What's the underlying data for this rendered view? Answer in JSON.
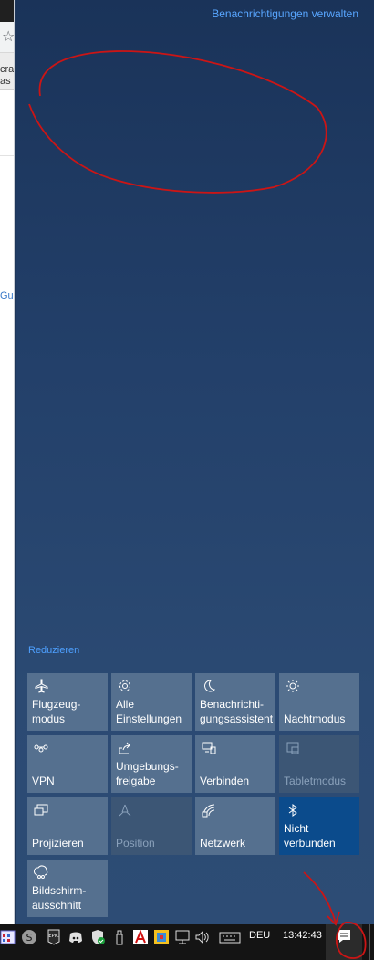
{
  "background_app": {
    "tab_text_1": "cra",
    "tab_text_2": "as",
    "link_text": "Gu"
  },
  "action_center": {
    "manage_notifications": "Benachrichtigungen verwalten",
    "collapse": "Reduzieren",
    "tiles": [
      {
        "label": "Flugzeug-\nmodus",
        "icon": "airplane-icon",
        "state": "off"
      },
      {
        "label": "Alle\nEinstellungen",
        "icon": "gear-icon",
        "state": "off"
      },
      {
        "label": "Benachrichti-\ngungsassistent",
        "icon": "moon-icon",
        "state": "off"
      },
      {
        "label": "Nachtmodus",
        "icon": "brightness-icon",
        "state": "off"
      },
      {
        "label": "VPN",
        "icon": "vpn-icon",
        "state": "off"
      },
      {
        "label": "Umgebungs-\nfreigabe",
        "icon": "share-icon",
        "state": "off"
      },
      {
        "label": "Verbinden",
        "icon": "connect-icon",
        "state": "off"
      },
      {
        "label": "Tabletmodus",
        "icon": "tablet-icon",
        "state": "disabled"
      },
      {
        "label": "Projizieren",
        "icon": "project-icon",
        "state": "off"
      },
      {
        "label": "Position",
        "icon": "location-icon",
        "state": "disabled"
      },
      {
        "label": "Netzwerk",
        "icon": "network-icon",
        "state": "off"
      },
      {
        "label": "Nicht\nverbunden",
        "icon": "bluetooth-icon",
        "state": "on"
      },
      {
        "label": "Bildschirm-\nausschnitt",
        "icon": "snip-icon",
        "state": "off"
      }
    ]
  },
  "taskbar": {
    "language": "DEU",
    "time": "13:42:43",
    "tray_icons": [
      "calendar-icon",
      "skype-icon",
      "epic-games-icon",
      "discord-icon",
      "defender-icon",
      "usb-icon",
      "avira-icon",
      "app-icon",
      "network-icon",
      "volume-icon",
      "keyboard-icon"
    ],
    "notification_icon": "action-center-icon"
  },
  "colors": {
    "panel": "#23406a",
    "tile": "#55708f",
    "tile_active": "#0b4b8c",
    "accent_link": "#4ea0ff",
    "annotation": "#cc1515"
  }
}
